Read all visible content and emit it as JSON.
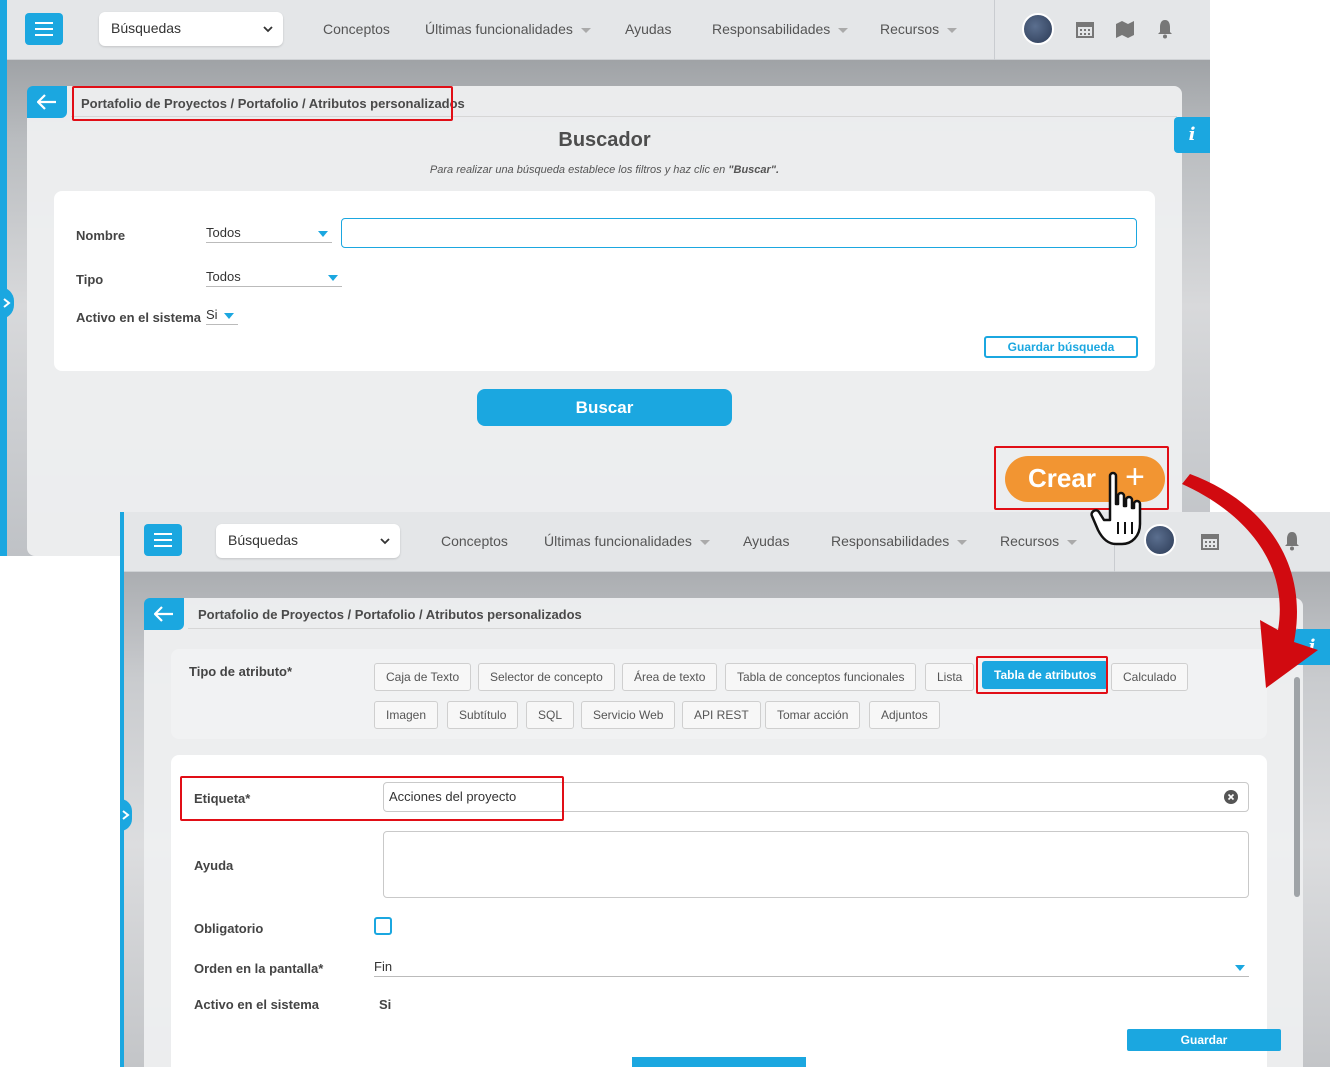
{
  "topbar": {
    "search_select": "Búsquedas",
    "nav": [
      "Conceptos",
      "Últimas funcionalidades",
      "Ayudas",
      "Responsabilidades",
      "Recursos"
    ],
    "nav_has_caret": [
      false,
      true,
      false,
      true,
      true
    ],
    "icons": [
      "calendar-icon",
      "map-icon",
      "bell-icon"
    ]
  },
  "breadcrumb": "Portafolio de Proyectos / Portafolio / Atributos personalizados",
  "info_label": "i",
  "screen1": {
    "title": "Buscador",
    "subtitle_prefix": "Para realizar una búsqueda establece los filtros y haz clic en ",
    "subtitle_bold": "\"Buscar\".",
    "fields": {
      "nombre_label": "Nombre",
      "nombre_filter": "Todos",
      "tipo_label": "Tipo",
      "tipo_value": "Todos",
      "activo_label": "Activo en el sistema",
      "activo_value": "Si"
    },
    "save_search_button": "Guardar búsqueda",
    "search_button": "Buscar",
    "create_button": "Crear",
    "create_icon": "+"
  },
  "screen2": {
    "tipo_label": "Tipo de atributo*",
    "types_row1": [
      "Caja de Texto",
      "Selector de concepto",
      "Área de texto",
      "Tabla de conceptos funcionales",
      "Lista",
      "Tabla de atributos",
      "Calculado"
    ],
    "types_row2": [
      "Imagen",
      "Subtítulo",
      "SQL",
      "Servicio Web",
      "API REST",
      "Tomar acción",
      "Adjuntos"
    ],
    "selected_type": "Tabla de atributos",
    "etiqueta_label": "Etiqueta*",
    "etiqueta_value": "Acciones del proyecto",
    "ayuda_label": "Ayuda",
    "ayuda_value": "",
    "obligatorio_label": "Obligatorio",
    "obligatorio_checked": false,
    "orden_label": "Orden en la pantalla*",
    "orden_value": "Fin",
    "activo_label": "Activo en el sistema",
    "activo_value": "Si",
    "save_button": "Guardar"
  },
  "colors": {
    "accent": "#1ba7e0",
    "create": "#f29532",
    "highlight": "#e10e16"
  }
}
